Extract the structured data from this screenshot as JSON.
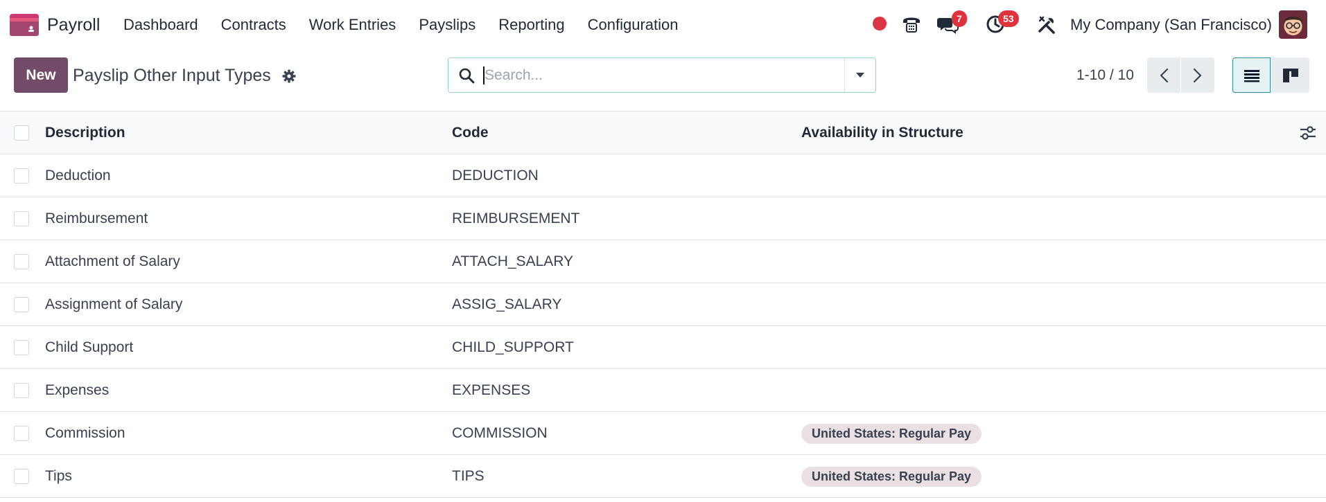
{
  "navbar": {
    "app_name": "Payroll",
    "menu": [
      "Dashboard",
      "Contracts",
      "Work Entries",
      "Payslips",
      "Reporting",
      "Configuration"
    ],
    "discuss_badge": "7",
    "activity_badge": "53",
    "company": "My Company (San Francisco)",
    "brand_color": "#714b67"
  },
  "control_panel": {
    "new_label": "New",
    "title": "Payslip Other Input Types",
    "search_placeholder": "Search...",
    "pager": "1-10 / 10"
  },
  "list": {
    "headers": {
      "description": "Description",
      "code": "Code",
      "availability": "Availability in Structure"
    },
    "rows": [
      {
        "description": "Deduction",
        "code": "DEDUCTION",
        "structure": ""
      },
      {
        "description": "Reimbursement",
        "code": "REIMBURSEMENT",
        "structure": ""
      },
      {
        "description": "Attachment of Salary",
        "code": "ATTACH_SALARY",
        "structure": ""
      },
      {
        "description": "Assignment of Salary",
        "code": "ASSIG_SALARY",
        "structure": ""
      },
      {
        "description": "Child Support",
        "code": "CHILD_SUPPORT",
        "structure": ""
      },
      {
        "description": "Expenses",
        "code": "EXPENSES",
        "structure": ""
      },
      {
        "description": "Commission",
        "code": "COMMISSION",
        "structure": "United States: Regular Pay"
      },
      {
        "description": "Tips",
        "code": "TIPS",
        "structure": "United States: Regular Pay"
      }
    ]
  }
}
